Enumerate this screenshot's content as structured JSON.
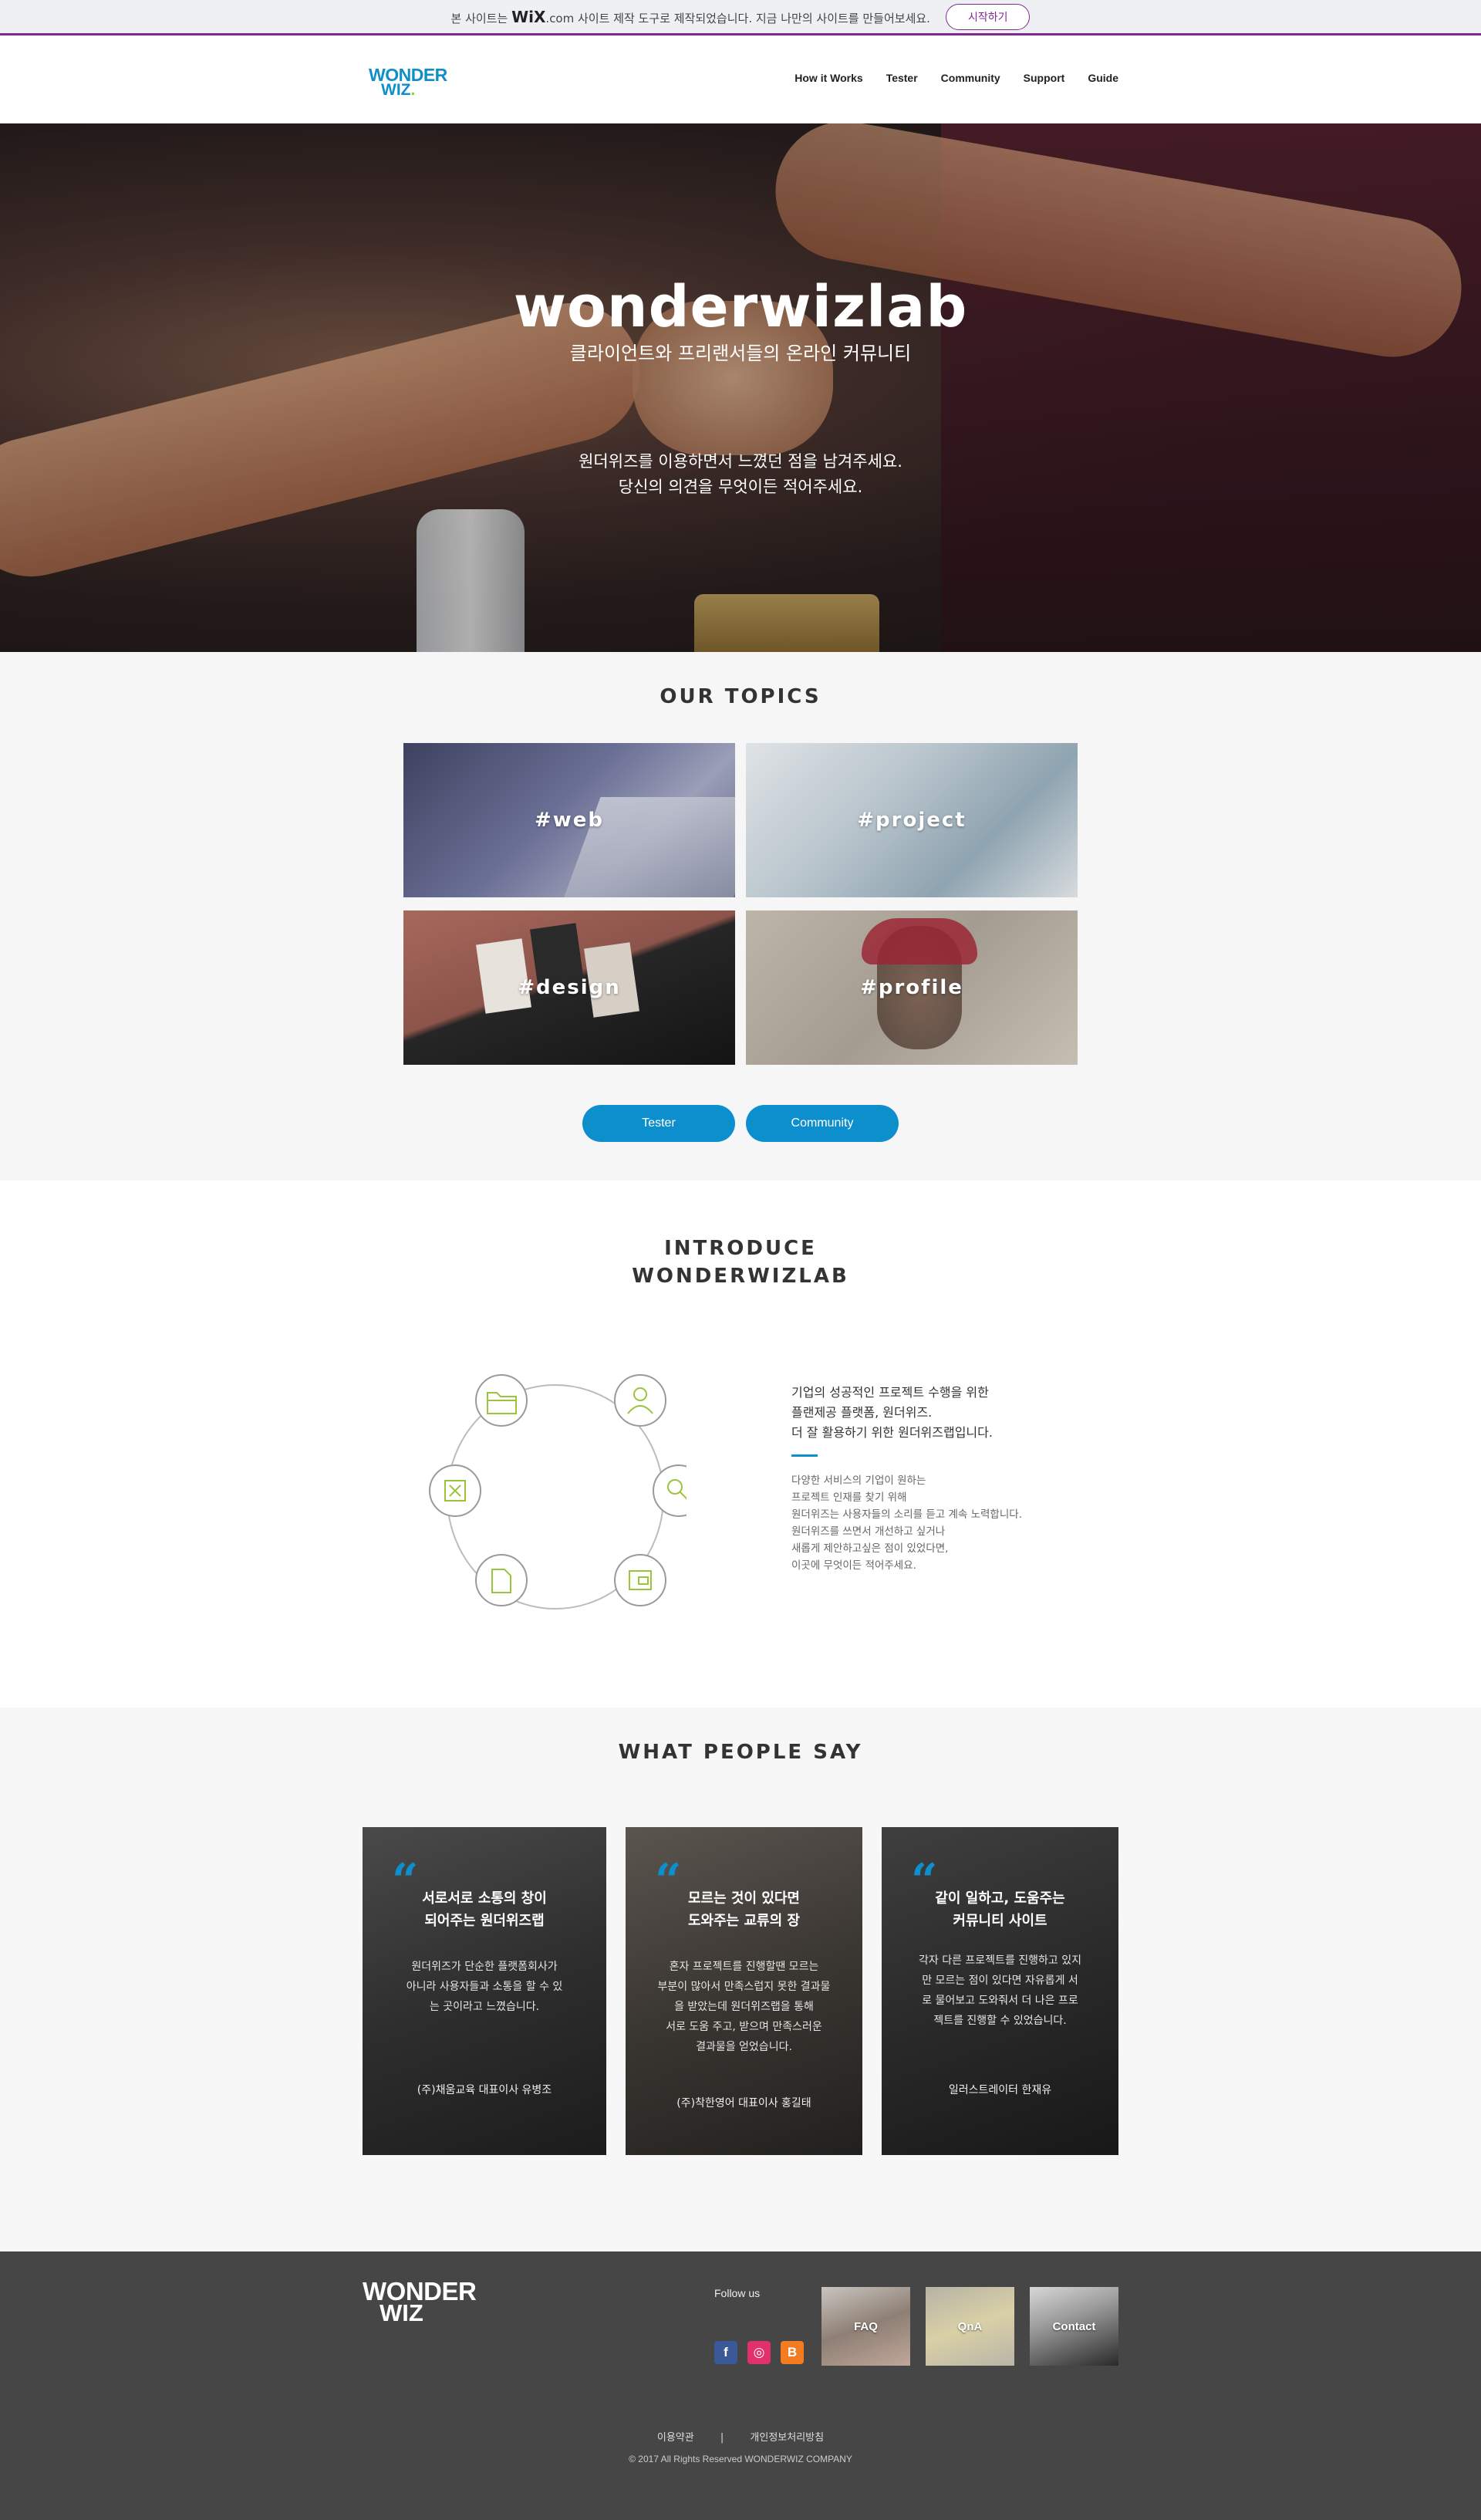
{
  "wix_banner": {
    "text_before": "본 사이트는",
    "brand": "WiX",
    "brand_suffix": ".com",
    "text_after": "사이트 제작 도구로 제작되었습니다. 지금 나만의 사이트를 만들어보세요.",
    "button": "시작하기"
  },
  "header": {
    "logo_line1": "WONDER",
    "logo_line2_a": "WIZ",
    "logo_line2_b": ".",
    "nav": [
      "How it Works",
      "Tester",
      "Community",
      "Support",
      "Guide"
    ]
  },
  "hero": {
    "title": "wonderwizlab",
    "subtitle": "클라이언트와 프리랜서들의 온라인 커뮤니티",
    "message_line1": "원더위즈를 이용하면서 느꼈던 점을 남겨주세요.",
    "message_line2": "당신의 의견을 무엇이든 적어주세요."
  },
  "topics": {
    "title": "OUR TOPICS",
    "tiles": [
      "#web",
      "#project",
      "#design",
      "#profile"
    ],
    "buttons": [
      "Tester",
      "Community"
    ]
  },
  "introduce": {
    "title_line1": "INTRODUCE",
    "title_line2": "WONDERWIZLAB",
    "diagram_icons": [
      "folder-icon",
      "user-icon",
      "search-icon",
      "document-icon",
      "wallet-icon",
      "close-box-icon"
    ],
    "heading": [
      "기업의 성공적인 프로젝트 수행을 위한",
      "플랜제공 플랫폼, 원더위즈.",
      "더 잘 활용하기 위한 원더위즈랩입니다."
    ],
    "body": [
      "다양한 서비스의 기업이 원하는",
      "프로젝트 인재를 찾기 위해",
      "원더위즈는 사용자들의 소리를 듣고 계속 노력합니다.",
      "원더위즈를 쓰면서 개선하고 싶거나",
      "새롭게 제안하고싶은 점이 있었다면,",
      "이곳에 무엇이든 적어주세요."
    ]
  },
  "people": {
    "title": "WHAT PEOPLE SAY",
    "quote_mark": "“",
    "cards": [
      {
        "heading": [
          "서로서로 소통의 창이",
          "되어주는 원더위즈랩"
        ],
        "body": [
          "원더위즈가 단순한 플랫폼회사가",
          "아니라 사용자들과 소통을 할 수 있",
          "는 곳이라고 느꼈습니다."
        ],
        "author": "(주)채움교육 대표이사 유병조"
      },
      {
        "heading": [
          "모르는 것이 있다면",
          "도와주는 교류의 장"
        ],
        "body": [
          "혼자 프로젝트를 진행할땐 모르는",
          "부분이 많아서 만족스럽지 못한 결과물",
          "을 받았는데 원더위즈랩을 통해",
          "서로 도움 주고, 받으며 만족스러운",
          "결과물을 얻었습니다."
        ],
        "author": "(주)착한영어 대표이사 홍길태"
      },
      {
        "heading": [
          "같이 일하고, 도움주는",
          "커뮤니티 사이트"
        ],
        "body": [
          "각자 다른 프로젝트를 진행하고 있지",
          "만 모르는 점이 있다면 자유롭게 서",
          "로 물어보고 도와줘서 더 나은 프로",
          "젝트를 진행할 수 있었습니다."
        ],
        "author": "일러스트레이터 한재유"
      }
    ]
  },
  "footer": {
    "logo_line1": "WONDER",
    "logo_line2": "WIZ",
    "follow": "Follow us",
    "social": [
      "facebook-icon",
      "instagram-icon",
      "blogger-icon"
    ],
    "social_glyphs": [
      "f",
      "◎",
      "B"
    ],
    "thumbs": [
      "FAQ",
      "QnA",
      "Contact"
    ],
    "links": [
      "이용약관",
      "|",
      "개인정보처리방침"
    ],
    "copyright": "© 2017 All Rights Reserved WONDERWIZ COMPANY"
  },
  "colors": {
    "accent": "#0d8fcd",
    "wix_purple": "#7e2b8f",
    "icon_green": "#9ac53a",
    "footer_bg": "#464646"
  }
}
